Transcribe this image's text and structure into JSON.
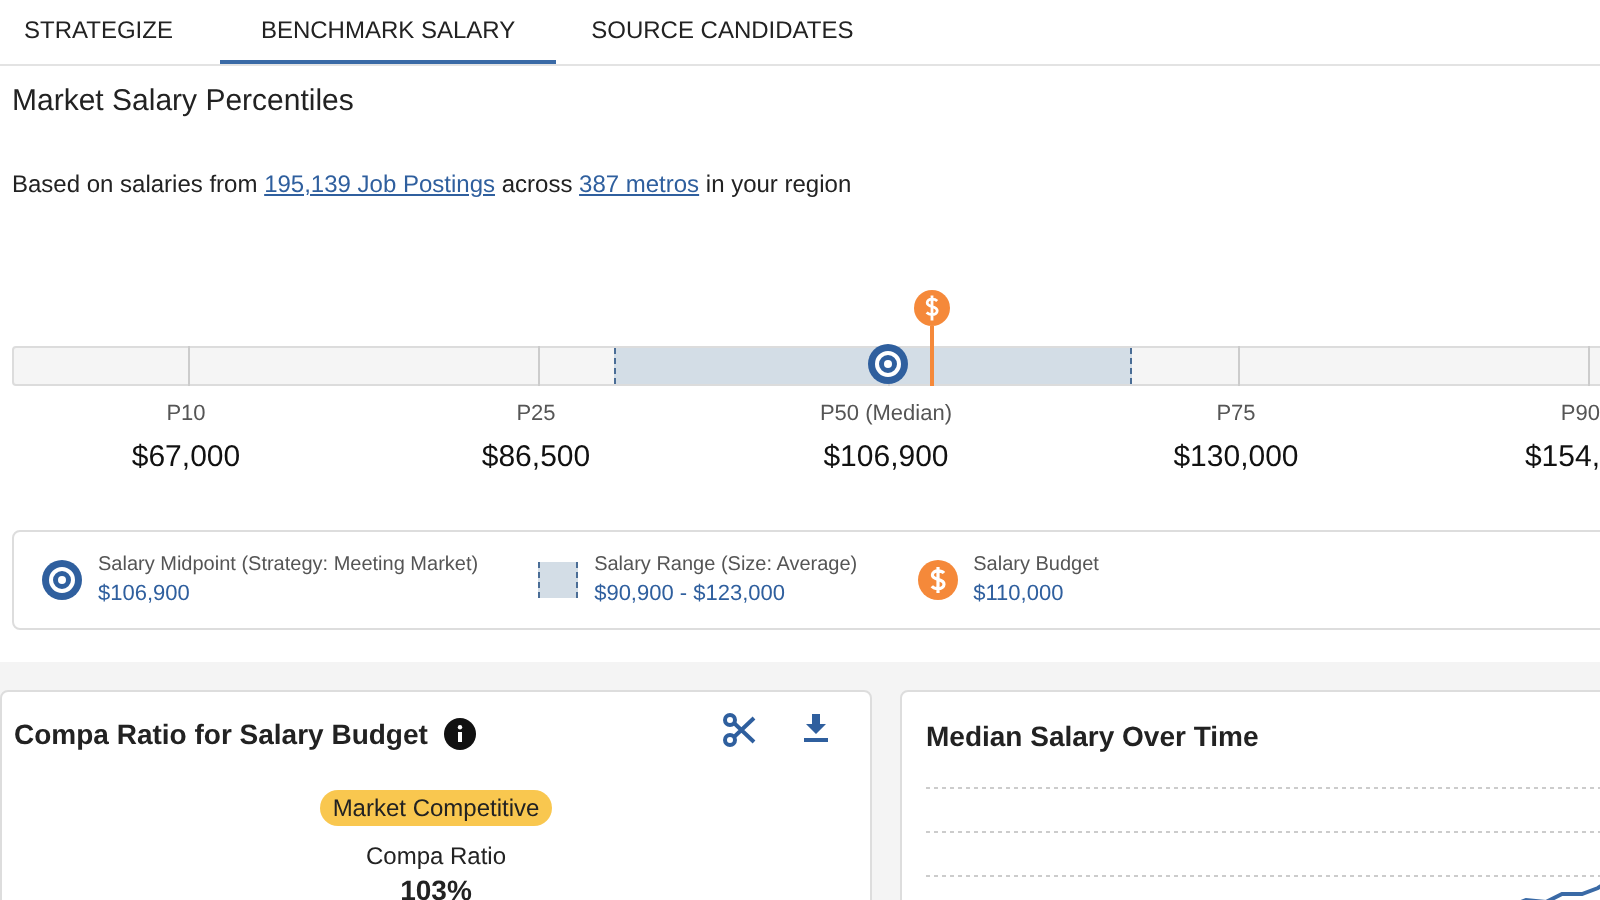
{
  "tabs": [
    {
      "label": "STRATEGIZE",
      "selected": false
    },
    {
      "label": "BENCHMARK SALARY",
      "selected": true
    },
    {
      "label": "SOURCE CANDIDATES",
      "selected": false
    }
  ],
  "section_title": "Market Salary Percentiles",
  "source_note": {
    "before": "Based on salaries from",
    "link_1": "195,139 Job Postings",
    "middle": "across",
    "link_2": "387 metros",
    "after": "in your region"
  },
  "percentiles": [
    {
      "label": "P10",
      "value": "$67,000"
    },
    {
      "label": "P25",
      "value": "$86,500"
    },
    {
      "label": "P50 (Median)",
      "value": "$106,900"
    },
    {
      "label": "P75",
      "value": "$130,000"
    },
    {
      "label": "P90",
      "value": "$154,"
    }
  ],
  "legend": [
    {
      "kind": "midpoint",
      "label": "Salary Midpoint (Strategy: Meeting Market)",
      "value": "$106,900"
    },
    {
      "kind": "range",
      "label": "Salary Range (Size: Average)",
      "value": "$90,900 - $123,000"
    },
    {
      "kind": "budget",
      "label": "Salary Budget",
      "value": "$110,000"
    }
  ],
  "compa_card": {
    "title": "Compa Ratio for Salary Budget",
    "badge": "Market Competitive",
    "metric_label": "Compa Ratio",
    "metric_value": "103%"
  },
  "trend_card": {
    "title": "Median Salary Over Time"
  }
}
